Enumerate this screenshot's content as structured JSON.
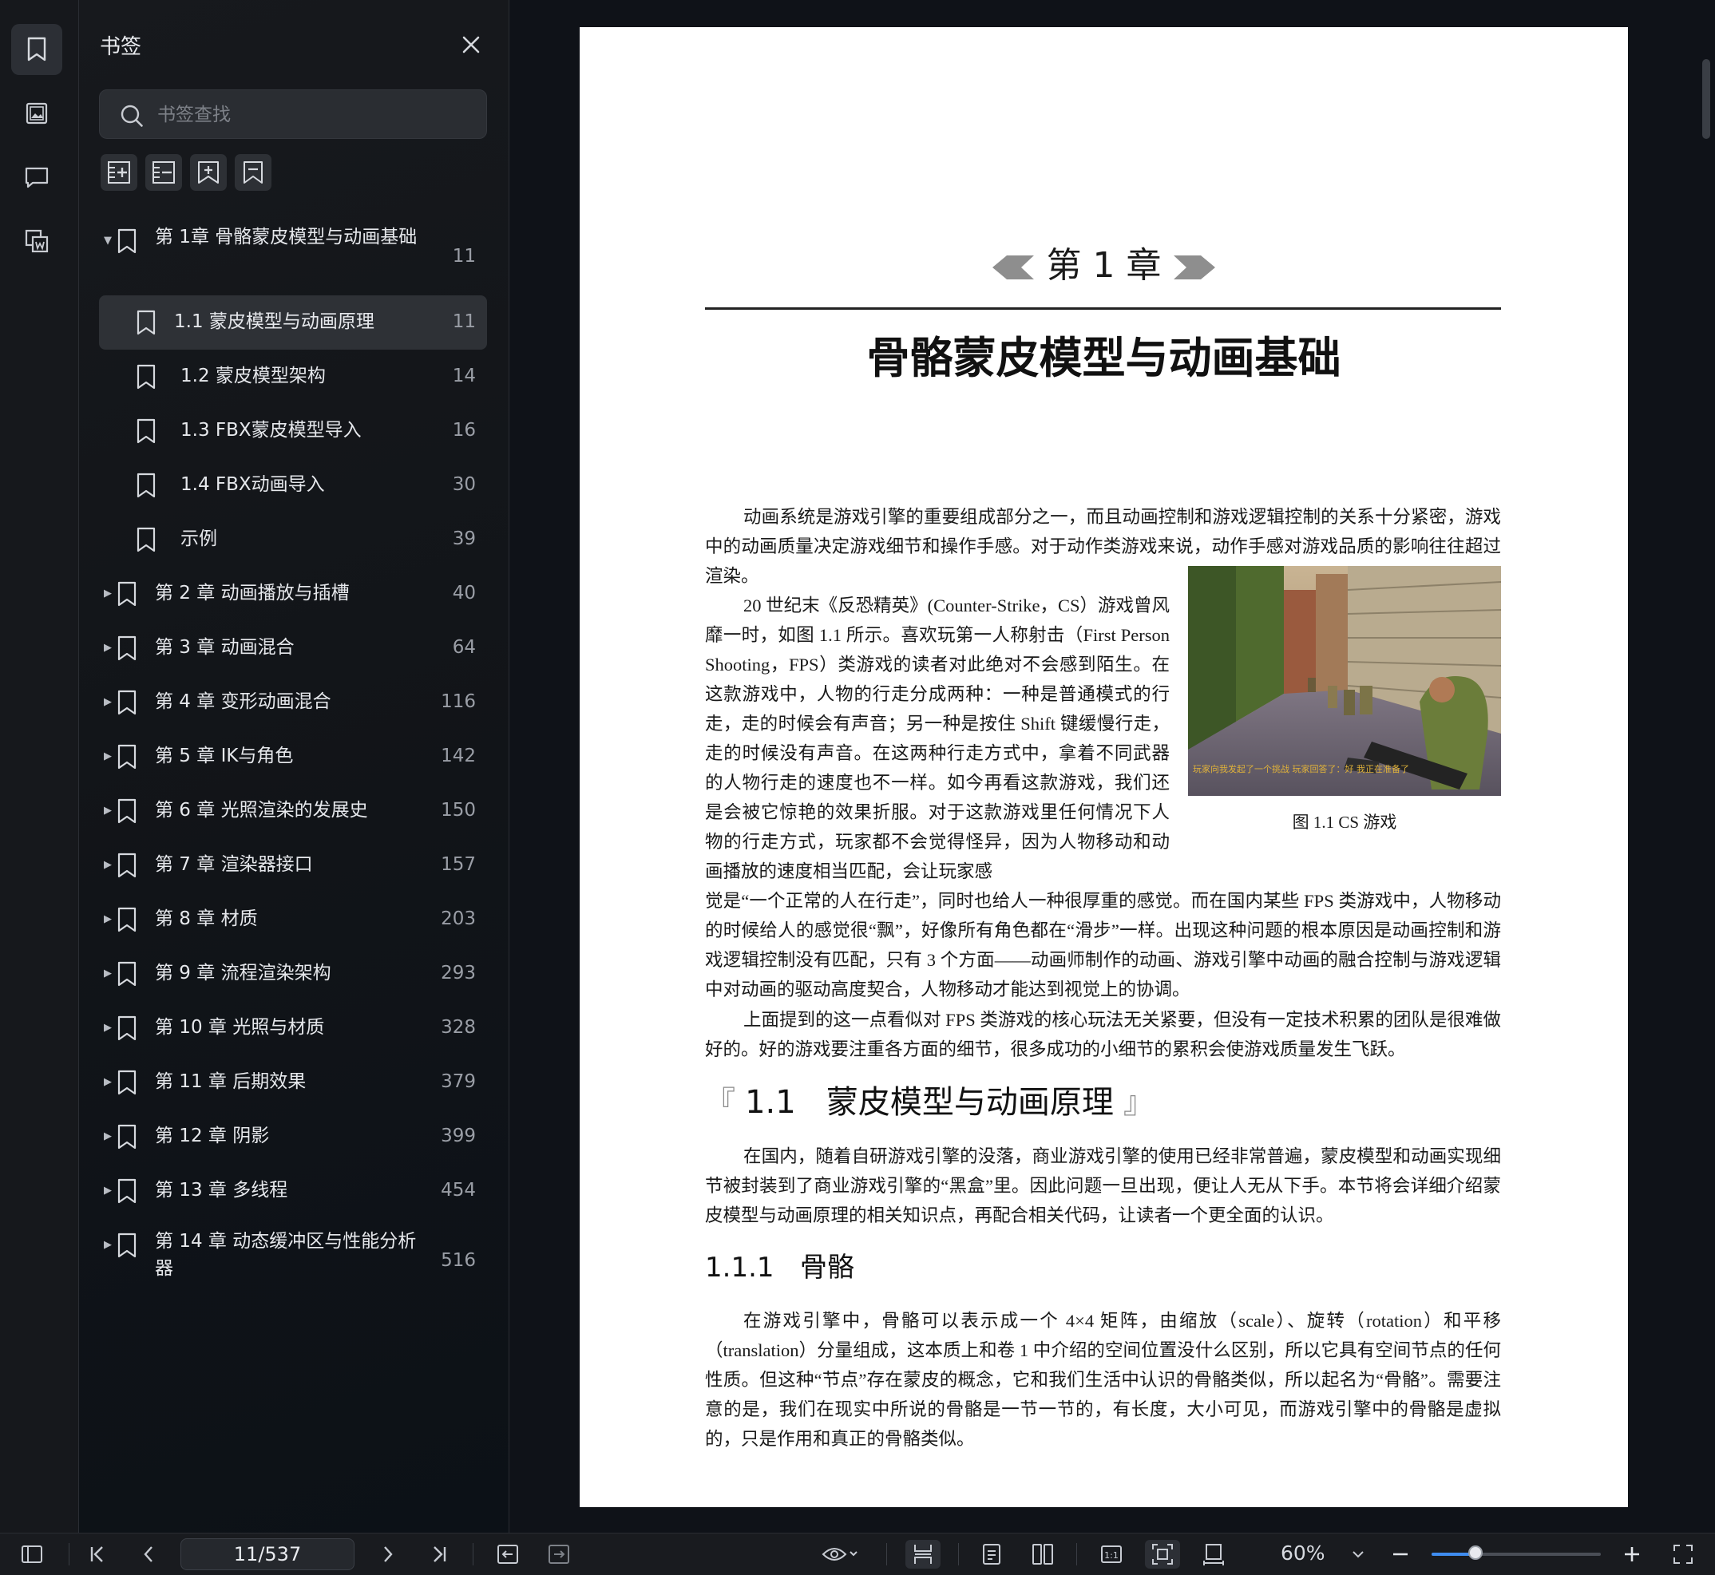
{
  "sidebar": {
    "title": "书签",
    "search_placeholder": "书签查找",
    "rail_icons": [
      "bookmark-icon",
      "image-icon",
      "comment-icon",
      "thumbnail-icon"
    ],
    "tool_icons": [
      "expand-all-icon",
      "collapse-all-icon",
      "add-bookmark-icon",
      "bookmark-flag-icon"
    ],
    "items": [
      {
        "label": "第 1章 骨骼蒙皮模型与动画基础",
        "page": "11",
        "level": 0,
        "expanded": true
      },
      {
        "label": "1.1 蒙皮模型与动画原理",
        "page": "11",
        "level": 1,
        "selected": true
      },
      {
        "label": "1.2 蒙皮模型架构",
        "page": "14",
        "level": 1
      },
      {
        "label": "1.3 FBX蒙皮模型导入",
        "page": "16",
        "level": 1
      },
      {
        "label": "1.4 FBX动画导入",
        "page": "30",
        "level": 1
      },
      {
        "label": "示例",
        "page": "39",
        "level": 1
      },
      {
        "label": "第 2 章 动画播放与插槽",
        "page": "40",
        "level": 0
      },
      {
        "label": "第 3 章 动画混合",
        "page": "64",
        "level": 0
      },
      {
        "label": "第 4 章 变形动画混合",
        "page": "116",
        "level": 0
      },
      {
        "label": "第 5 章 IK与角色",
        "page": "142",
        "level": 0
      },
      {
        "label": "第 6 章 光照渲染的发展史",
        "page": "150",
        "level": 0
      },
      {
        "label": "第 7 章 渲染器接口",
        "page": "157",
        "level": 0
      },
      {
        "label": "第 8 章 材质",
        "page": "203",
        "level": 0
      },
      {
        "label": "第 9 章 流程渲染架构",
        "page": "293",
        "level": 0
      },
      {
        "label": "第 10 章 光照与材质",
        "page": "328",
        "level": 0
      },
      {
        "label": "第 11 章 后期效果",
        "page": "379",
        "level": 0
      },
      {
        "label": "第 12 章 阴影",
        "page": "399",
        "level": 0
      },
      {
        "label": "第 13 章 多线程",
        "page": "454",
        "level": 0
      },
      {
        "label": "第 14 章 动态缓冲区与性能分析器",
        "page": "516",
        "level": 0
      }
    ]
  },
  "document": {
    "chapter_number": "第 1 章",
    "chapter_title": "骨骼蒙皮模型与动画基础",
    "para1": "动画系统是游戏引擎的重要组成部分之一，而且动画控制和游戏逻辑控制的关系十分紧密，游戏中的动画质量决定游戏细节和操作手感。对于动作类游戏来说，动作手感对游戏品质的影响往往超过渲染。",
    "para2a": "20 世纪末《反恐精英》(Counter-Strike，CS）游戏曾风靡一时，如图 1.1 所示。喜欢玩第一人称射击（First Person Shooting，FPS）类游戏的读者对此绝对不会感到陌生。在这款游戏中，人物的行走分成两种：一种是普通模式的行走，走的时候会有声音；另一种是按住 Shift 键缓慢行走，走的时候没有声音。在这两种行走方式中，拿着不同武器的人物行走的速度也不一样。如今再看这款游戏，我们还是会被它惊艳的效果折服。对于这款游戏里任何情况下人物的行走方式，玩家都不会觉得怪异，因为人物移动和动画播放的速度相当匹配，会让玩家感",
    "para2b": "觉是“一个正常的人在行走”，同时也给人一种很厚重的感觉。而在国内某些 FPS 类游戏中，人物移动的时候给人的感觉很“飘”，好像所有角色都在“滑步”一样。出现这种问题的根本原因是动画控制和游戏逻辑控制没有匹配，只有 3 个方面——动画师制作的动画、游戏引擎中动画的融合控制与游戏逻辑中对动画的驱动高度契合，人物移动才能达到视觉上的协调。",
    "para3": "上面提到的这一点看似对 FPS 类游戏的核心玩法无关紧要，但没有一定技术积累的团队是很难做好的。好的游戏要注重各方面的细节，很多成功的小细节的累积会使游戏质量发生飞跃。",
    "figure_caption": "图 1.1    CS 游戏",
    "figure_overlay_text": "玩家向我发起了一个挑战 玩家回答了：好 我正在准备了",
    "section_number": "1.1",
    "section_title": "蒙皮模型与动画原理",
    "para4": "在国内，随着自研游戏引擎的没落，商业游戏引擎的使用已经非常普遍，蒙皮模型和动画实现细节被封装到了商业游戏引擎的“黑盒”里。因此问题一旦出现，便让人无从下手。本节将会详细介绍蒙皮模型与动画原理的相关知识点，再配合相关代码，让读者一个更全面的认识。",
    "subsection_number": "1.1.1",
    "subsection_title": "骨骼",
    "para5": "在游戏引擎中，骨骼可以表示成一个 4×4 矩阵，由缩放（scale）、旋转（rotation）和平移（translation）分量组成，这本质上和卷 1 中介绍的空间位置没什么区别，所以它具有空间节点的任何性质。但这种“节点”存在蒙皮的概念，它和我们生活中认识的骨骼类似，所以起名为“骨骼”。需要注意的是，我们在现实中所说的骨骼是一节一节的，有长度，大小可见，而游戏引擎中的骨骼是虚拟的，只是作用和真正的骨骼类似。"
  },
  "toolbar": {
    "page_indicator": "11/537",
    "zoom": "60%",
    "zoom_level": 0.6,
    "accent": "#3f8df0"
  }
}
